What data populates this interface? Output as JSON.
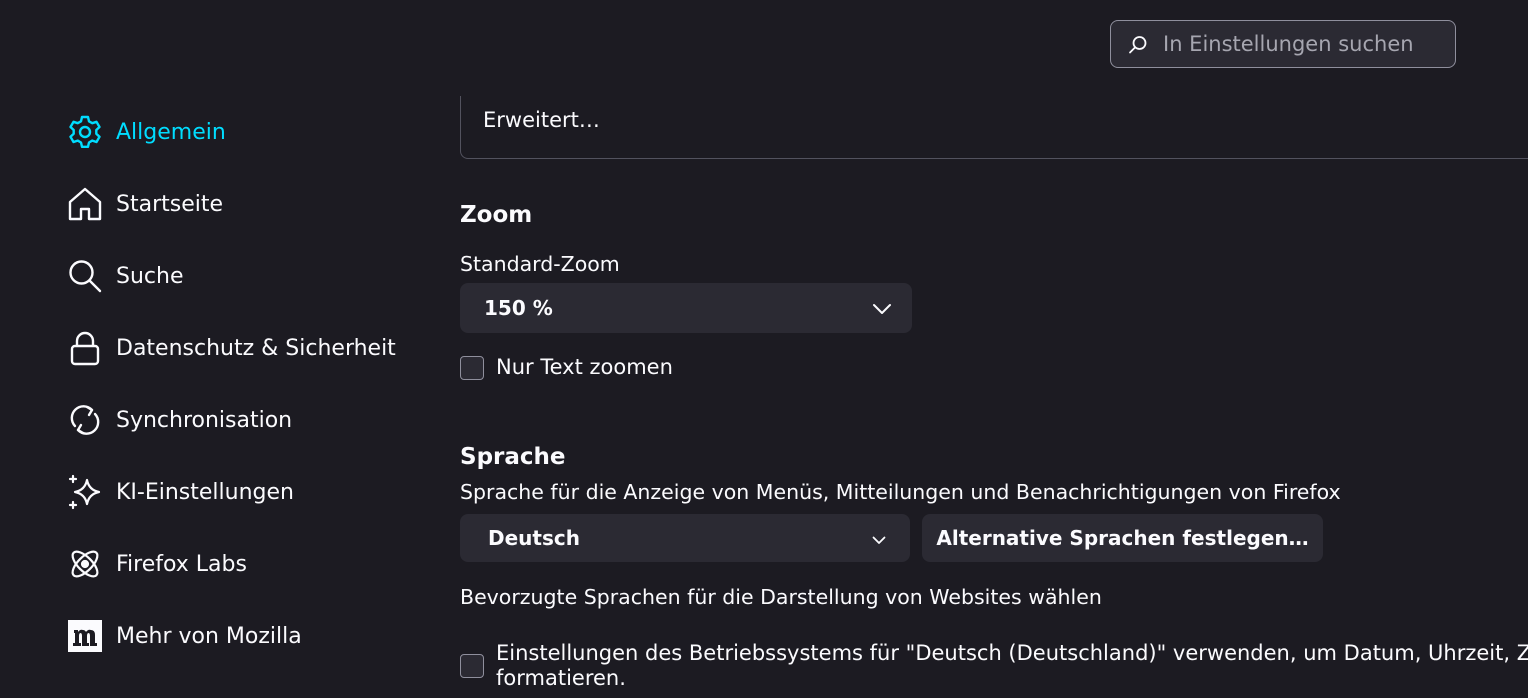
{
  "search": {
    "placeholder": "In Einstellungen suchen"
  },
  "sidebar": {
    "items": [
      {
        "label": "Allgemein",
        "icon": "gear-icon",
        "selected": true
      },
      {
        "label": "Startseite",
        "icon": "home-icon"
      },
      {
        "label": "Suche",
        "icon": "search-icon"
      },
      {
        "label": "Datenschutz & Sicherheit",
        "icon": "lock-icon"
      },
      {
        "label": "Synchronisation",
        "icon": "sync-icon"
      },
      {
        "label": "KI-Einstellungen",
        "icon": "sparkle-icon"
      },
      {
        "label": "Firefox Labs",
        "icon": "atom-icon"
      },
      {
        "label": "Mehr von Mozilla",
        "icon": "mozilla-m-icon"
      }
    ]
  },
  "fonts_section": {
    "advanced_button": "Erweitert…"
  },
  "zoom": {
    "heading": "Zoom",
    "default_label": "Standard-Zoom",
    "default_value": "150 %",
    "text_only_label": "Nur Text zoomen"
  },
  "language": {
    "heading": "Sprache",
    "description": "Sprache für die Anzeige von Menüs, Mitteilungen und Benachrichtigungen von Firefox",
    "selected_language": "Deutsch",
    "alternative_button": "Alternative Sprachen festlegen…",
    "websites_label": "Bevorzugte Sprachen für die Darstellung von Websites wählen",
    "os_settings_line1": "Einstellungen des Betriebssystems für \"Deutsch (Deutschland)\" verwenden, um Datum, Uhrzeit, Zahlen",
    "os_settings_line2": "formatieren."
  },
  "colors": {
    "background": "#1c1b22",
    "accent": "#00ddff",
    "control_bg": "#2b2a33",
    "text": "#fbfbfe"
  }
}
